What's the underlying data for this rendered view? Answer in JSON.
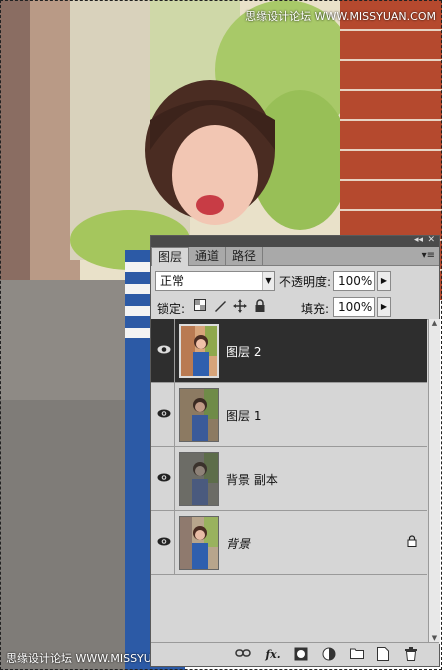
{
  "watermark": {
    "top": "思缘设计论坛 WWW.MISSYUAN.COM",
    "bottom": "思缘设计论坛 WWW.MISSYUAN.COM"
  },
  "panel": {
    "tabs": [
      {
        "label": "图层",
        "active": true
      },
      {
        "label": "通道",
        "active": false
      },
      {
        "label": "路径",
        "active": false
      }
    ],
    "blend_mode": "正常",
    "opacity_label": "不透明度:",
    "opacity_value": "100%",
    "lock_label": "锁定:",
    "fill_label": "填充:",
    "fill_value": "100%",
    "layers": [
      {
        "name": "图层 2",
        "selected": true,
        "italic": false,
        "locked": false,
        "visible": true
      },
      {
        "name": "图层 1",
        "selected": false,
        "italic": false,
        "locked": false,
        "visible": true
      },
      {
        "name": "背景 副本",
        "selected": false,
        "italic": false,
        "locked": false,
        "visible": true
      },
      {
        "name": "背景",
        "selected": false,
        "italic": true,
        "locked": true,
        "visible": true
      }
    ],
    "bottom_icons": [
      "link-icon",
      "fx-icon",
      "mask-icon",
      "adjustment-icon",
      "group-icon",
      "new-layer-icon",
      "trash-icon"
    ]
  }
}
